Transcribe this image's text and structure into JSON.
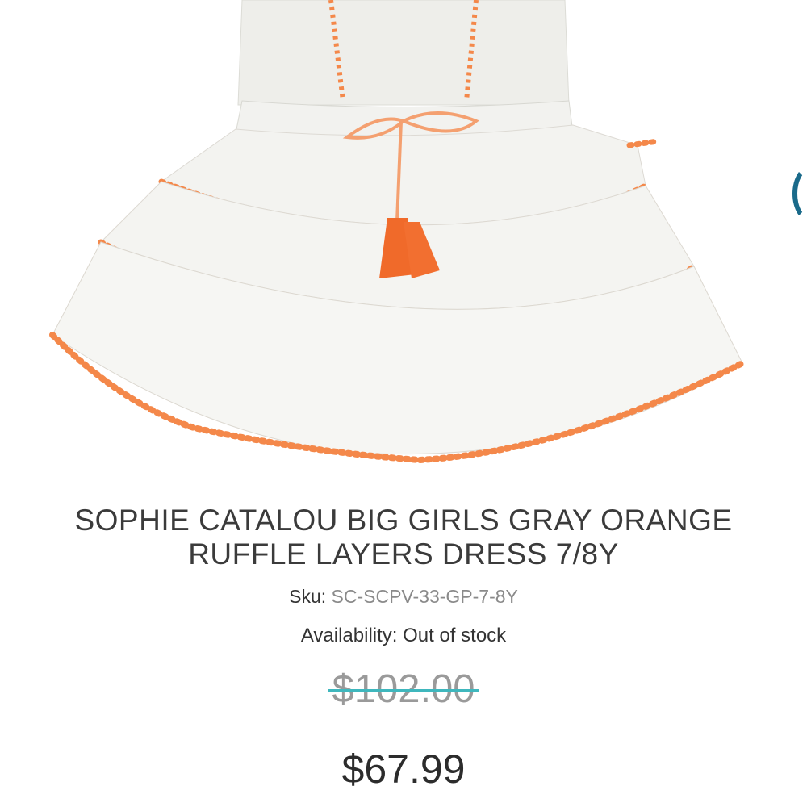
{
  "product": {
    "title_line1": "SOPHIE CATALOU BIG GIRLS GRAY ORANGE",
    "title_line2": "RUFFLE LAYERS DRESS 7/8Y",
    "sku_label": "Sku:",
    "sku_value": "SC-SCPV-33-GP-7-8Y",
    "availability": "Availability: Out of stock",
    "original_price": "$102.00",
    "sale_price": "$67.99"
  },
  "colors": {
    "dress_fabric": "#efefeb",
    "trim_orange": "#f4884a",
    "tassel_orange": "#f06a2a",
    "strike_teal": "#3fb7bd",
    "nav_arrow": "#1a6a8a"
  },
  "icons": {
    "next_image": "chevron-right-icon"
  }
}
